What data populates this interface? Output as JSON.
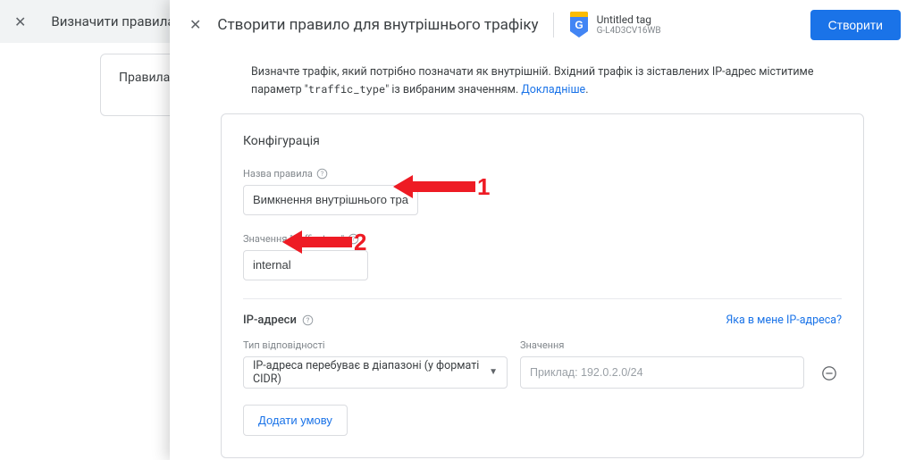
{
  "background": {
    "header_title": "Визначити правила д",
    "card_text": "Правила дл"
  },
  "overlay": {
    "title": "Створити правило для внутрішнього трафіку",
    "tag": {
      "name": "Untitled tag",
      "id": "G-L4D3CV16WB"
    },
    "create_button": "Створити",
    "intro_part1": "Визначте трафік, який потрібно позначати як внутрішній. Вхідний трафік із зіставлених IP-адрес міститиме параметр \"",
    "intro_mono": "traffic_type",
    "intro_part2": "\" із вибраним значенням. ",
    "intro_link": "Докладніше"
  },
  "config": {
    "card_title": "Конфігурація",
    "rule_name_label": "Назва правила",
    "rule_name_value": "Вимкнення внутрішнього трафіка",
    "traffic_type_label": "Значення \"traffic_type\"",
    "traffic_type_value": "internal",
    "ip_section_label": "IP-адреси",
    "ip_link": "Яка в мене IP-адреса?",
    "match_type_label": "Тип відповідності",
    "match_type_value": "IP-адреса перебуває в діапазоні (у форматі CIDR)",
    "value_label": "Значення",
    "value_placeholder": "Приклад: 192.0.2.0/24",
    "add_condition": "Додати умову"
  },
  "annotations": {
    "n1": "1",
    "n2": "2"
  }
}
